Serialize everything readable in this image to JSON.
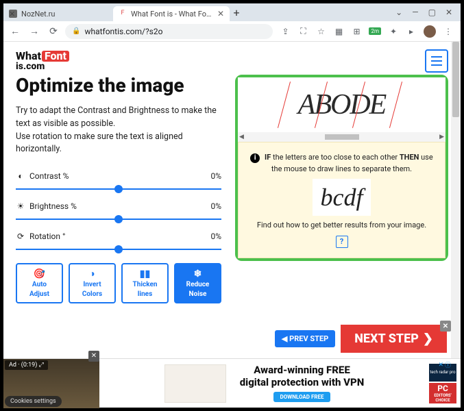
{
  "browser": {
    "tabs": [
      {
        "title": "NozNet.ru",
        "favicon": "#555"
      },
      {
        "title": "What Font is - What Font Is",
        "favicon": "#d44"
      }
    ],
    "url": "whatfontis.com/?s2o",
    "win_down": "⌄",
    "win_min": "—",
    "win_max": "▢",
    "win_close": "✕"
  },
  "logo": {
    "what": "What",
    "font": "Font",
    "iscom": "is.com"
  },
  "page": {
    "title": "Optimize the image",
    "desc1": "Try to adapt the Contrast and Brightness to make the text as visible as possible.",
    "desc2": "Use rotation to make sure the text is aligned horizontally."
  },
  "sliders": [
    {
      "label": "Contrast %",
      "value": "0%",
      "icon": "◐"
    },
    {
      "label": "Brightness %",
      "value": "0%",
      "icon": "☀"
    },
    {
      "label": "Rotation °",
      "value": "0%",
      "icon": "⟳"
    }
  ],
  "tools": [
    {
      "icon": "🎯",
      "line1": "Auto",
      "line2": "Adjust"
    },
    {
      "icon": "◑",
      "line1": "Invert",
      "line2": "Colors"
    },
    {
      "icon": "▮▮",
      "line1": "Thicken",
      "line2": "lines"
    },
    {
      "icon": "❄",
      "line1": "Reduce",
      "line2": "Noise"
    }
  ],
  "preview": {
    "sample_text": "ABODE",
    "info_if": "IF",
    "info_mid": " the letters are too close to each other ",
    "info_then": "THEN",
    "info_end": " use the mouse to draw lines to separate them.",
    "bcdf": "bcdf",
    "findout": "Find out how to get better results from your image.",
    "help": "?"
  },
  "nav": {
    "prev": "◀ PREV STEP",
    "next": "NEXT STEP",
    "next_arrow": "❯"
  },
  "ad": {
    "label": "Ad · (0:19)",
    "cookies": "Cookies settings",
    "head1": "Award-winning FREE",
    "head2": "digital protection with VPN",
    "download": "DOWNLOAD FREE",
    "badge1": "tech radar pro",
    "badge2a": "PC",
    "badge2b": "EDITORS' CHOICE",
    "adx": "✕",
    "adi": "ⓘ"
  }
}
